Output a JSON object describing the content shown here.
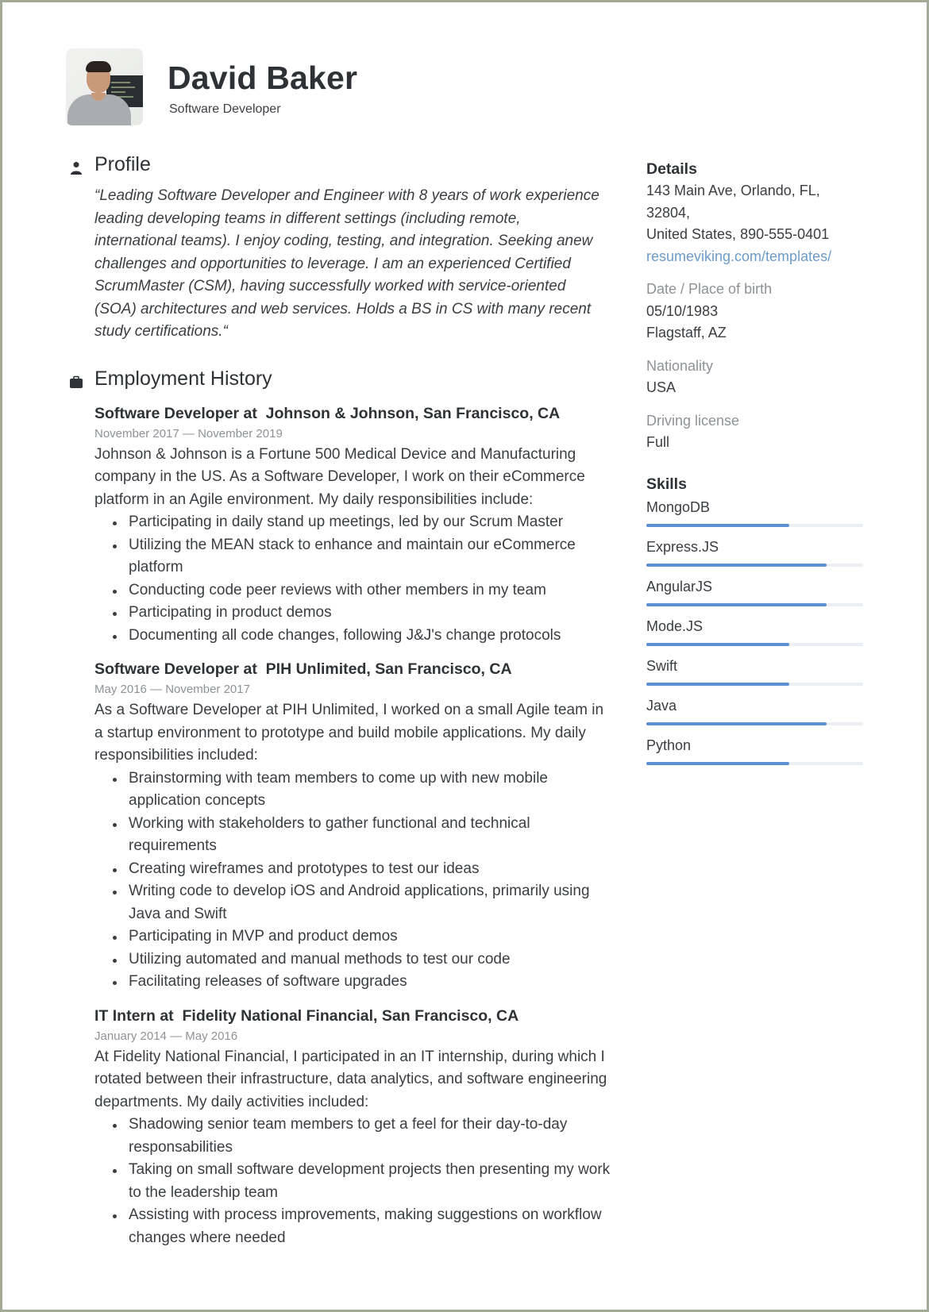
{
  "header": {
    "name": "David Baker",
    "subtitle": "Software Developer",
    "photo_alt": "profile-photo"
  },
  "profile": {
    "title": "Profile",
    "icon": "person-icon",
    "text": "“Leading Software Developer and Engineer with 8 years of work experience leading developing teams in different settings (including remote, international teams). I enjoy coding, testing, and integration. Seeking anew challenges and opportunities to leverage. I am an experienced Certified ScrumMaster (CSM), having successfully worked with service-oriented (SOA) architectures and web services. Holds a BS in CS with many recent study certifications.“"
  },
  "employment": {
    "title": "Employment History",
    "icon": "briefcase-icon",
    "jobs": [
      {
        "title": "Software Developer at  Johnson & Johnson, San Francisco, CA",
        "dates": "November 2017 — November 2019",
        "description": "Johnson & Johnson is a Fortune 500 Medical Device and Manufacturing company in the US. As a Software Developer, I work on their eCommerce platform in an Agile environment. My daily responsibilities include:",
        "bullets": [
          "Participating in daily stand up meetings, led by our Scrum Master",
          "Utilizing the MEAN stack to enhance and maintain our eCommerce platform",
          "Conducting code peer reviews with other members in my team",
          "Participating in product demos",
          "Documenting all code changes, following J&J's change protocols"
        ]
      },
      {
        "title": "Software Developer at  PIH Unlimited, San Francisco, CA",
        "dates": "May 2016 — November 2017",
        "description": "As a Software Developer at PIH Unlimited, I worked on a small Agile team in a startup environment to prototype and build mobile applications. My daily responsibilities included:",
        "bullets": [
          "Brainstorming with team members to come up with new mobile application concepts",
          "Working with stakeholders to gather functional and technical requirements",
          "Creating wireframes and prototypes to test our ideas",
          "Writing code to develop iOS and Android applications, primarily using Java and Swift",
          "Participating in MVP and product demos",
          "Utilizing automated and manual methods to test our code",
          "Facilitating releases of software upgrades"
        ]
      },
      {
        "title": "IT Intern at  Fidelity National Financial, San Francisco, CA",
        "dates": "January 2014 — May 2016",
        "description": "At Fidelity National Financial, I participated in an IT internship, during which I rotated between their infrastructure, data analytics, and software engineering departments. My daily activities included:",
        "bullets": [
          "Shadowing senior team members to get a feel for their day-to-day responsabilities",
          "Taking on small software development projects then presenting my work to the leadership team",
          "Assisting with process improvements, making suggestions on workflow changes where needed"
        ]
      }
    ]
  },
  "details": {
    "title": "Details",
    "address_line1": "143 Main Ave, Orlando, FL, 32804,",
    "address_line2": "United States, 890-555-0401",
    "link": "resumeviking.com/templates/",
    "birth_label": "Date / Place of birth",
    "birth_date": "05/10/1983",
    "birth_place": "Flagstaff, AZ",
    "nationality_label": "Nationality",
    "nationality": "USA",
    "license_label": "Driving license",
    "license": "Full"
  },
  "skills": {
    "title": "Skills",
    "accent_color": "#5b8fcf",
    "track_color": "#ebeef2",
    "items": [
      {
        "name": "MongoDB",
        "level": 0.66
      },
      {
        "name": "Express.JS",
        "level": 0.83
      },
      {
        "name": "AngularJS",
        "level": 0.83
      },
      {
        "name": "Mode.JS",
        "level": 0.66
      },
      {
        "name": "Swift",
        "level": 0.66
      },
      {
        "name": "Java",
        "level": 0.83
      },
      {
        "name": "Python",
        "level": 0.66
      }
    ]
  }
}
